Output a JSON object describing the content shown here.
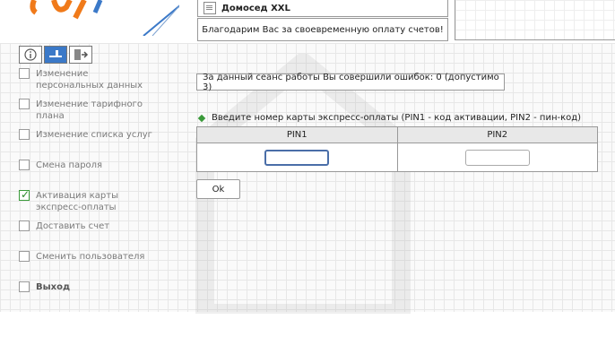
{
  "header": {
    "tariff_name": "Домосед XXL",
    "thanks_message": "Благодарим Вас за своевременную оплату счетов!"
  },
  "sidebar": {
    "tabs": [
      {
        "icon": "info-icon"
      },
      {
        "icon": "user-key-icon"
      },
      {
        "icon": "exit-door-icon"
      }
    ],
    "items": [
      {
        "label": "Изменение персональных данных",
        "checked": false
      },
      {
        "label": "Изменение тарифного плана",
        "checked": false
      },
      {
        "label": "Изменение списка услуг",
        "checked": false
      },
      {
        "label": "Смена пароля",
        "checked": false
      },
      {
        "label": "Активация карты экспресс-оплаты",
        "checked": true
      },
      {
        "label": "Доставить счет",
        "checked": false
      },
      {
        "label": "Сменить пользователя",
        "checked": false
      },
      {
        "label": "Выход",
        "checked": false
      }
    ]
  },
  "main": {
    "errors_text": "За данный сеанс работы Вы совершили ошибок: 0 (допустимо 3)",
    "instruction": "Введите номер карты экспресс-оплаты (PIN1 - код активации, PIN2 - пин-код)",
    "table": {
      "headers": [
        "PIN1",
        "PIN2"
      ],
      "pin1_value": "",
      "pin2_value": ""
    },
    "ok_label": "Ok"
  },
  "colors": {
    "accent_blue": "#3b79c8",
    "check_green": "#2b8a2b",
    "logo_orange": "#f07a1a"
  }
}
